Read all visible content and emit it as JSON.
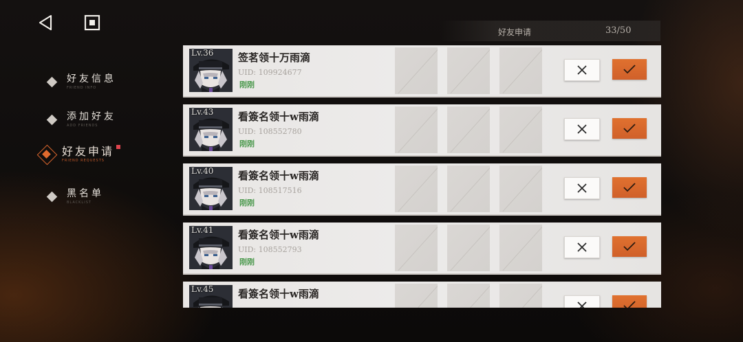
{
  "nav": {
    "back_icon": "back-triangle-icon",
    "home_icon": "square-stop-icon"
  },
  "sidebar": {
    "items": [
      {
        "label": "好友信息",
        "sub": "FRIEND INFO"
      },
      {
        "label": "添加好友",
        "sub": "ADD FRIENDS"
      },
      {
        "label": "好友申请",
        "sub": "FRIEND REQUESTS"
      },
      {
        "label": "黑名单",
        "sub": "BLACKLIST"
      }
    ]
  },
  "header": {
    "title": "好友申请",
    "count": "33/50"
  },
  "requests": [
    {
      "level": "Lv.36",
      "name": "签茗领十万雨滴",
      "uid": "UID: 109924677",
      "status": "刚刚"
    },
    {
      "level": "Lv.43",
      "name": "看簽名领十w雨滴",
      "uid": "UID: 108552780",
      "status": "刚刚"
    },
    {
      "level": "Lv.40",
      "name": "看簽名领十w雨滴",
      "uid": "UID: 108517516",
      "status": "刚刚"
    },
    {
      "level": "Lv.41",
      "name": "看簽名领十w雨滴",
      "uid": "UID: 108552793",
      "status": "刚刚"
    },
    {
      "level": "Lv.45",
      "name": "看簽名领十w雨滴",
      "uid": "",
      "status": ""
    }
  ],
  "colors": {
    "accent": "#d9662c",
    "status_green": "#4d9a4f",
    "badge_red": "#e0444e"
  }
}
